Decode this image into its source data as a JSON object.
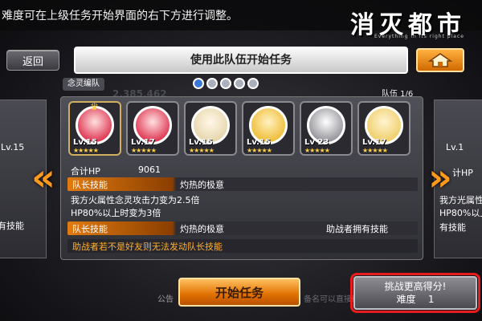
{
  "hint_text": "难度可在上级任务开始界面的右下方进行调整。",
  "logo": {
    "title": "消灭都市",
    "tagline": "Everything in its right place"
  },
  "header": {
    "back_label": "返回",
    "title": "使用此队伍开始任务",
    "home_icon": "home-icon"
  },
  "team": {
    "name": "念灵编队",
    "score_ghost": "2,385,462",
    "party_index": "队伍 1/6",
    "page_dots": 5,
    "active_dot": 0
  },
  "members": [
    {
      "level": "Lv.15",
      "leader": true,
      "color": "#e0405a",
      "stars": "★★★★★"
    },
    {
      "level": "Lv.17",
      "leader": false,
      "color": "#e0405a",
      "stars": "★★★★★"
    },
    {
      "level": "Lv.15",
      "leader": false,
      "color": "#e8d8b0",
      "stars": "★★★★★"
    },
    {
      "level": "Lv.15",
      "leader": false,
      "color": "#f0c040",
      "stars": "★★★★★"
    },
    {
      "level": "Lv 23",
      "leader": false,
      "color": "#cfcfd4",
      "stars": "★★★★★"
    },
    {
      "level": "Lv.17",
      "leader": false,
      "color": "#f0d070",
      "stars": "★★★★★"
    }
  ],
  "stats": {
    "hp_label": "合计HP",
    "hp_value": "9061",
    "leader_skill_label": "队长技能",
    "leader_skill_name": "灼热的极意",
    "leader_skill_desc1": "我方火属性念灵攻击力变为2.5倍",
    "leader_skill_desc2": "HP80%以上时变为3倍",
    "helper_skill_label": "队长技能",
    "helper_skill_name": "灼热的极意",
    "helper_has_skill": "助战者拥有技能",
    "helper_warning": "助战者若不是好友则无法发动队长技能"
  },
  "side_left": {
    "level": "Lv.15",
    "text1": "有技能"
  },
  "side_right": {
    "level": "Lv.1",
    "hp": "计HP",
    "line1": "我方光属性",
    "line2": "HP80%以上",
    "line3": "有技能"
  },
  "bottom": {
    "start_label": "开始任务",
    "challenge_label": "挑战更高得分!",
    "difficulty_label": "难度",
    "difficulty_value": "1",
    "announce": "公告",
    "ghost_msg": "备名可以直接确"
  }
}
